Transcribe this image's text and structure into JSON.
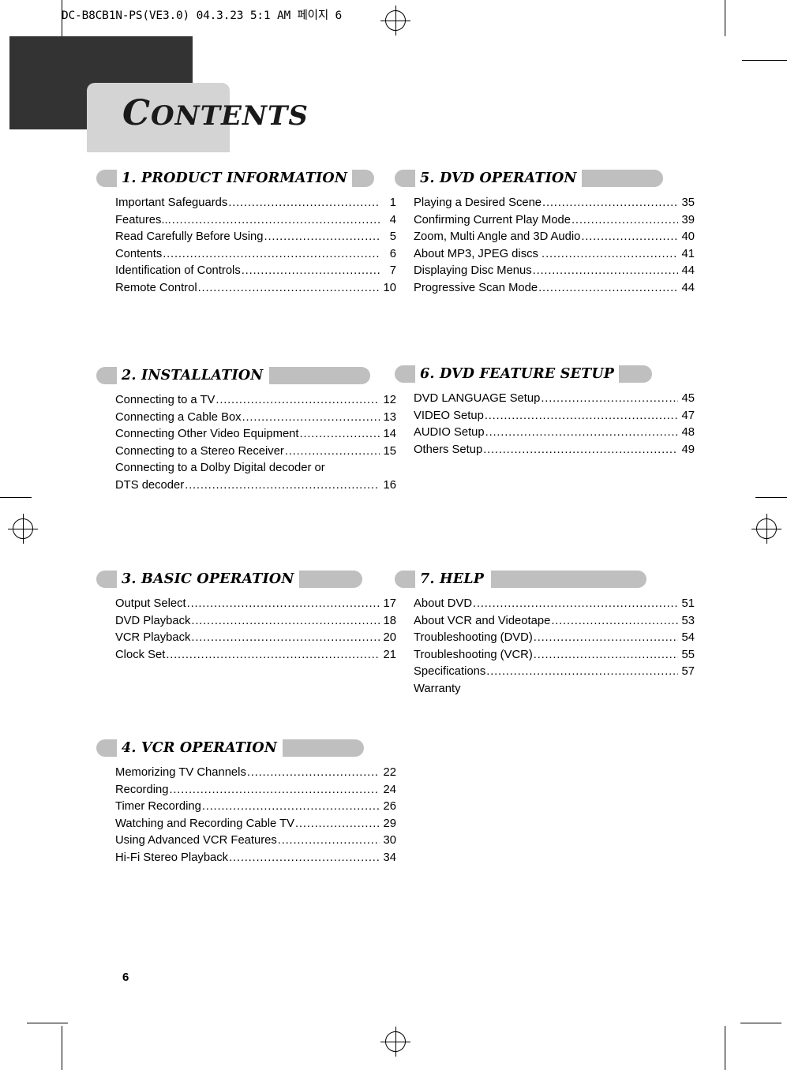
{
  "slug": "DC-B8CB1N-PS(VE3.0)  04.3.23 5:1 AM  페이지 6",
  "title": {
    "first_letter": "C",
    "rest": "ONTENTS"
  },
  "folio": "6",
  "sections": [
    {
      "id": "product-information",
      "column": "left",
      "heading": "1. PRODUCT INFORMATION",
      "tail_width": 28,
      "entries": [
        {
          "label": "Important Safeguards",
          "page": "1"
        },
        {
          "label": "Features...",
          "page": "4"
        },
        {
          "label": "Read Carefully Before Using",
          "page": "5"
        },
        {
          "label": "Contents",
          "page": "6"
        },
        {
          "label": "Identification of Controls",
          "page": "7"
        },
        {
          "label": "Remote Control",
          "page": "10"
        }
      ]
    },
    {
      "id": "installation",
      "column": "left",
      "heading": "2. INSTALLATION",
      "tail_width": 128,
      "entries": [
        {
          "label": "Connecting to a TV",
          "page": "12"
        },
        {
          "label": "Connecting a Cable Box",
          "page": "13"
        },
        {
          "label": "Connecting Other Video Equipment",
          "page": "14"
        },
        {
          "label": "Connecting to a Stereo Receiver",
          "page": "15"
        },
        {
          "label": "Connecting  to a Dolby Digital decoder or",
          "label2": "DTS  decoder",
          "page": "16",
          "wrap": true
        }
      ]
    },
    {
      "id": "basic-operation",
      "column": "left",
      "heading": "3. BASIC OPERATION",
      "tail_width": 80,
      "entries": [
        {
          "label": "Output Select",
          "page": "17"
        },
        {
          "label": "DVD Playback",
          "page": "18"
        },
        {
          "label": "VCR Playback",
          "page": "20"
        },
        {
          "label": "Clock Set",
          "page": "21"
        }
      ]
    },
    {
      "id": "vcr-operation",
      "column": "left",
      "heading": "4. VCR OPERATION",
      "tail_width": 103,
      "entries": [
        {
          "label": "Memorizing TV Channels",
          "page": "22"
        },
        {
          "label": "Recording",
          "page": "24"
        },
        {
          "label": "Timer Recording",
          "page": "26"
        },
        {
          "label": "Watching and Recording Cable TV",
          "page": "29"
        },
        {
          "label": "Using Advanced VCR Features",
          "page": "30"
        },
        {
          "label": "Hi-Fi Stereo Playback",
          "page": "34"
        }
      ]
    },
    {
      "id": "dvd-operation",
      "column": "right",
      "heading": "5. DVD OPERATION",
      "tail_width": 103,
      "entries": [
        {
          "label": "Playing a Desired Scene",
          "page": "35"
        },
        {
          "label": "Confirming Current Play Mode",
          "page": "39"
        },
        {
          "label": "Zoom, Multi Angle and 3D Audio",
          "page": "40"
        },
        {
          "label": "About MP3, JPEG discs .",
          "page": "41"
        },
        {
          "label": "Displaying Disc Menus",
          "page": "44"
        },
        {
          "label": "Progressive Scan Mode",
          "page": "44"
        }
      ]
    },
    {
      "id": "dvd-feature-setup",
      "column": "right",
      "heading": "6. DVD FEATURE SETUP",
      "tail_width": 42,
      "entries": [
        {
          "label": "DVD LANGUAGE Setup",
          "page": "45"
        },
        {
          "label": "VIDEO Setup",
          "page": "47"
        },
        {
          "label": "AUDIO Setup",
          "page": "48"
        },
        {
          "label": "Others Setup",
          "page": "49"
        }
      ]
    },
    {
      "id": "help",
      "column": "right",
      "heading": "7. HELP",
      "tail_width": 197,
      "entries": [
        {
          "label": "About DVD",
          "page": "51"
        },
        {
          "label": "About VCR and Videotape",
          "page": "53"
        },
        {
          "label": "Troubleshooting (DVD)",
          "page": "54"
        },
        {
          "label": "Troubleshooting (VCR)",
          "page": "55"
        },
        {
          "label": "Specifications",
          "page": "57"
        },
        {
          "label": "Warranty",
          "page": "",
          "nodots": true
        }
      ]
    }
  ]
}
